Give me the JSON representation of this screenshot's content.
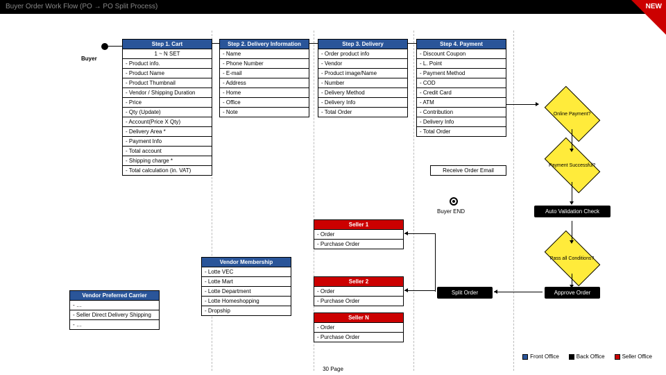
{
  "title": "Buyer Order Work Flow (PO → PO Split Process)",
  "badge": "NEW",
  "buyer_label": "Buyer",
  "end_label": "Buyer END",
  "receive_email": "Receive Order Email",
  "steps": {
    "s1": {
      "head": "Step 1. Cart",
      "sub": "1 ~ N SET",
      "rows": [
        "- Product info.",
        "- Product Name",
        "- Product Thumbnail",
        "- Vendor / Shipping Duration",
        "- Price",
        "- Qty (Update)",
        "- Account(Price X Qty)",
        "- Delivery Area *",
        "- Payment Info",
        "- Total account",
        "- Shipping charge *",
        "- Total calculation (in. VAT)"
      ]
    },
    "s2": {
      "head": "Step 2. Delivery Information",
      "rows": [
        "- Name",
        "- Phone Number",
        "- E-mail",
        "- Address",
        "- Home",
        "- Office",
        "- Note"
      ]
    },
    "s3": {
      "head": "Step 3. Delivery",
      "rows": [
        "- Order product info",
        "- Vendor",
        "- Product image/Name",
        "- Number",
        "- Delivery Method",
        "- Delivery Info",
        "- Total Order"
      ]
    },
    "s4": {
      "head": "Step 4. Payment",
      "rows": [
        "- Discount Coupon",
        "- L. Point",
        "- Payment Method",
        "- COD",
        "- Credit Card",
        "- ATM",
        "- Contribution",
        "- Delivery Info",
        "- Total Order"
      ]
    }
  },
  "decisions": {
    "d1": "Online Payment?",
    "d2": "Payment Successful?",
    "d3": "Pass all Conditions?"
  },
  "blackboxes": {
    "b1": "Auto Validation Check",
    "b2": "Split Order",
    "b3": "Approve Order"
  },
  "vendor_mem": {
    "head": "Vendor Membership",
    "rows": [
      "- Lotte VEC",
      "- Lotte Mart",
      "- Lotte Department",
      "- Lotte Homeshopping",
      "- Dropship"
    ]
  },
  "vpc": {
    "head": "Vendor Preferred Carrier",
    "rows": [
      "- …",
      "- Seller Direct Delivery Shipping",
      "- …"
    ]
  },
  "sellers": {
    "seller1": {
      "head": "Seller 1",
      "rows": [
        "- Order",
        "- Purchase Order"
      ]
    },
    "seller2": {
      "head": "Seller 2",
      "rows": [
        "- Order",
        "- Purchase Order"
      ]
    },
    "sellerN": {
      "head": "Seller N",
      "rows": [
        "- Order",
        "- Purchase Order"
      ]
    }
  },
  "legend": {
    "fo": "Front Office",
    "bo": "Back Office",
    "so": "Seller Office"
  },
  "pagenum": "30 Page"
}
